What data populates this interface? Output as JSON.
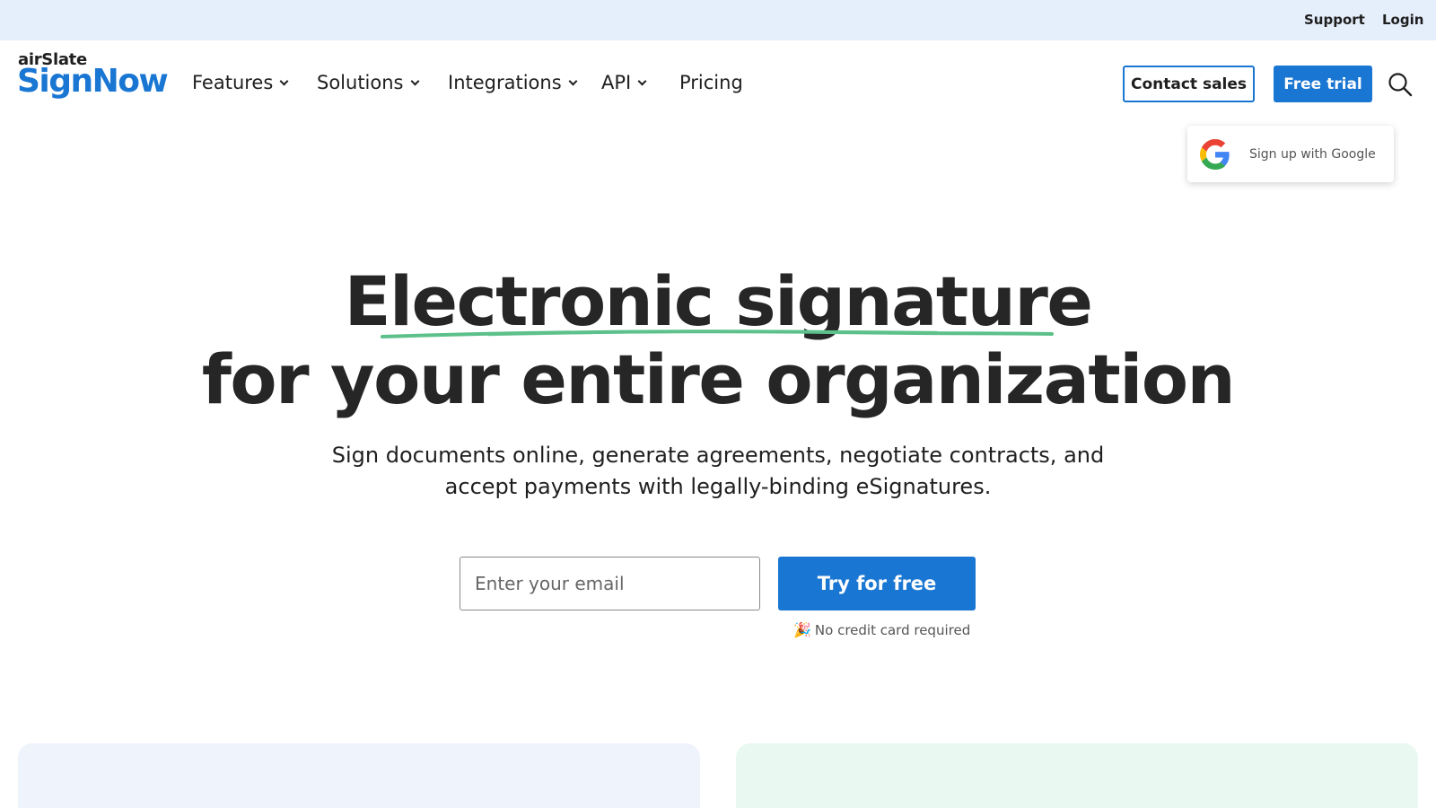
{
  "topbar": {
    "support": "Support",
    "login": "Login"
  },
  "logo": {
    "small": "airSlate",
    "big": "SignNow"
  },
  "nav": {
    "items": [
      {
        "label": "Features",
        "dropdown": true
      },
      {
        "label": "Solutions",
        "dropdown": true
      },
      {
        "label": "Integrations",
        "dropdown": true
      },
      {
        "label": "API",
        "dropdown": true
      },
      {
        "label": "Pricing",
        "dropdown": false
      }
    ]
  },
  "header_actions": {
    "contact_sales": "Contact sales",
    "free_trial": "Free trial",
    "search_icon": "search-icon"
  },
  "google_signup": {
    "label": "Sign up with Google",
    "icon": "google-icon"
  },
  "hero": {
    "title_line1": "Electronic signature",
    "title_line2": "for your entire organization",
    "subtitle": "Sign documents online, generate agreements, negotiate contracts, and accept payments with legally-binding eSignatures.",
    "underline_color": "#5cc08a"
  },
  "signup_form": {
    "email_placeholder": "Enter your email",
    "email_value": "",
    "cta": "Try for free",
    "note": "No credit card required",
    "note_icon": "🎉"
  },
  "colors": {
    "brand_blue": "#1976d2",
    "topbar_bg": "#e5eefb",
    "text": "#1f1f1f"
  }
}
